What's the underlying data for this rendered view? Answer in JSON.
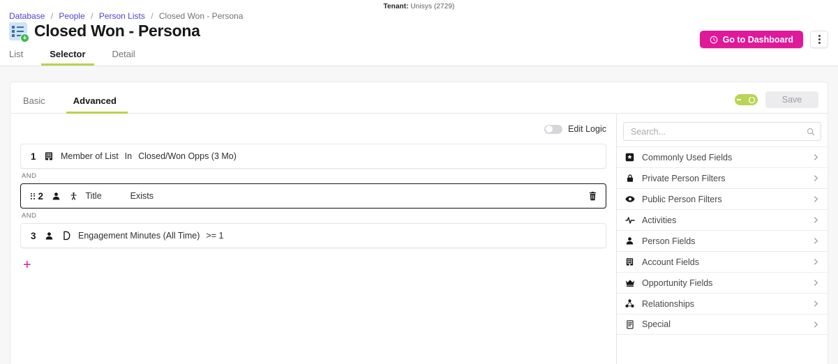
{
  "tenant": {
    "label": "Tenant:",
    "value": "Unisys (2729)"
  },
  "breadcrumb": {
    "items": [
      "Database",
      "People",
      "Person Lists"
    ],
    "current": "Closed Won - Persona",
    "separator": "/"
  },
  "header": {
    "title": "Closed Won - Persona",
    "title_icon": "list-download-icon",
    "dashboard_button": "Go to Dashboard",
    "dashboard_icon": "clock-icon",
    "kebab_icon": "more-vertical-icon",
    "accent_color": "#e0189a"
  },
  "page_tabs": [
    {
      "label": "List",
      "active": false
    },
    {
      "label": "Selector",
      "active": true
    },
    {
      "label": "Detail",
      "active": false
    }
  ],
  "mode_tabs": [
    {
      "label": "Basic",
      "active": false
    },
    {
      "label": "Advanced",
      "active": true
    }
  ],
  "card_actions": {
    "pill_toggle_icon": "reset-circle-icon",
    "pill_toggle_color": "#bad553",
    "save_label": "Save",
    "save_enabled": false
  },
  "builder": {
    "edit_logic_label": "Edit Logic",
    "edit_logic_on": false,
    "connector": "AND",
    "add_rule_label": "+",
    "rules": [
      {
        "index": "1",
        "icon": "building-icon",
        "icon2": null,
        "field": "Member of List",
        "operator": "In",
        "value": "Closed/Won Opps (3 Mo)",
        "selected": false,
        "draggable": false,
        "deletable": false
      },
      {
        "index": "2",
        "icon": "person-icon",
        "icon2": "person-standing-icon",
        "field": "Title",
        "operator": "Exists",
        "value": "",
        "selected": true,
        "draggable": true,
        "deletable": true
      },
      {
        "index": "3",
        "icon": "person-icon",
        "icon2": "demandbase-d-icon",
        "field": "Engagement Minutes (All Time)",
        "operator": ">= 1",
        "value": "",
        "selected": false,
        "draggable": false,
        "deletable": false
      }
    ]
  },
  "field_panel": {
    "search_placeholder": "Search...",
    "search_value": "",
    "search_icon": "search-icon",
    "items": [
      {
        "label": "Commonly Used Fields",
        "icon": "star-badge-icon"
      },
      {
        "label": "Private Person Filters",
        "icon": "lock-icon"
      },
      {
        "label": "Public Person Filters",
        "icon": "eye-icon"
      },
      {
        "label": "Activities",
        "icon": "pulse-icon"
      },
      {
        "label": "Person Fields",
        "icon": "person-icon"
      },
      {
        "label": "Account Fields",
        "icon": "building-icon"
      },
      {
        "label": "Opportunity Fields",
        "icon": "crown-icon"
      },
      {
        "label": "Relationships",
        "icon": "network-icon"
      },
      {
        "label": "Special",
        "icon": "document-icon"
      }
    ],
    "chevron_icon": "chevron-right-icon"
  }
}
